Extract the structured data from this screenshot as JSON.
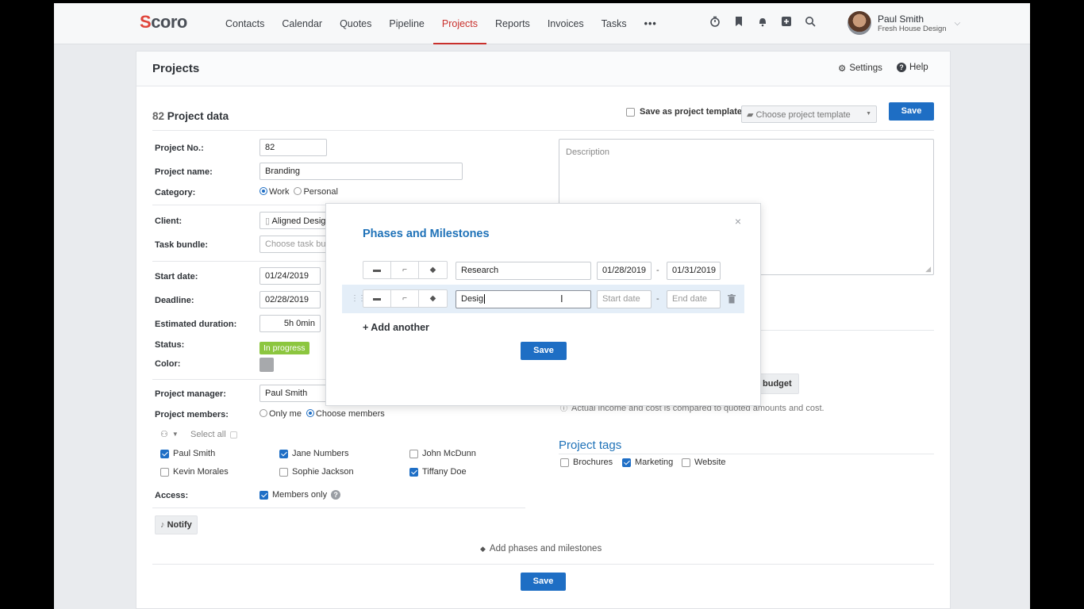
{
  "topbar": {
    "logo": "Scoro",
    "nav": [
      {
        "label": "Contacts",
        "active": false
      },
      {
        "label": "Calendar",
        "active": false
      },
      {
        "label": "Quotes",
        "active": false
      },
      {
        "label": "Pipeline",
        "active": false
      },
      {
        "label": "Projects",
        "active": true
      },
      {
        "label": "Reports",
        "active": false
      },
      {
        "label": "Invoices",
        "active": false
      },
      {
        "label": "Tasks",
        "active": false
      }
    ],
    "more": "•••",
    "icons": [
      "timer-icon",
      "bookmark-icon",
      "notifications-icon",
      "add-icon",
      "search-icon"
    ],
    "user": {
      "name": "Paul Smith",
      "org": "Fresh House Design"
    },
    "accent": "#c9302c"
  },
  "page": {
    "title": "Projects",
    "settings": "Settings",
    "help": "Help"
  },
  "project": {
    "number": "82",
    "title": "Project data",
    "save_template": "Save as project template",
    "choose_template": "Choose project template",
    "save": "Save",
    "fields": {
      "project_no_label": "Project No.:",
      "project_no": "82",
      "name_label": "Project name:",
      "name": "Branding",
      "category_label": "Category:",
      "category_work": "Work",
      "category_personal": "Personal",
      "client_label": "Client:",
      "client": "Aligned Desig",
      "task_bundle_label": "Task bundle:",
      "task_bundle_placeholder": "Choose task bun",
      "start_label": "Start date:",
      "start": "01/24/2019",
      "deadline_label": "Deadline:",
      "deadline": "02/28/2019",
      "duration_label": "Estimated duration:",
      "duration": "5h 0min",
      "status_label": "Status:",
      "status": "In progress",
      "status_color": "#8cc63f",
      "color_label": "Color:",
      "color_value": "#a7a9ac",
      "manager_label": "Project manager:",
      "manager": "Paul Smith",
      "members_label": "Project members:",
      "only_me": "Only me",
      "choose_members": "Choose members",
      "select_all": "Select all",
      "access_label": "Access:",
      "members_only": "Members only"
    },
    "members": [
      {
        "name": "Paul Smith",
        "checked": true
      },
      {
        "name": "Jane Numbers",
        "checked": true
      },
      {
        "name": "John McDunn",
        "checked": false
      },
      {
        "name": "Kevin Morales",
        "checked": false
      },
      {
        "name": "Sophie Jackson",
        "checked": false
      },
      {
        "name": "Tiffany Doe",
        "checked": true
      }
    ],
    "notify": "Notify",
    "add_phases": "Add phases and milestones",
    "description_placeholder": "Description",
    "budget_btn": "budget",
    "budget_note": "Actual income and cost is compared to quoted amounts and cost.",
    "tags_title": "Project tags",
    "tags": [
      {
        "name": "Brochures",
        "checked": false
      },
      {
        "name": "Marketing",
        "checked": true
      },
      {
        "name": "Website",
        "checked": false
      }
    ]
  },
  "modal": {
    "title": "Phases and Milestones",
    "close": "×",
    "rows": [
      {
        "name": "Research",
        "start": "01/28/2019",
        "end": "01/31/2019"
      },
      {
        "name": "Desig",
        "start_placeholder": "Start date",
        "end_placeholder": "End date"
      }
    ],
    "dash": "-",
    "add_another": "+ Add another",
    "save": "Save"
  }
}
